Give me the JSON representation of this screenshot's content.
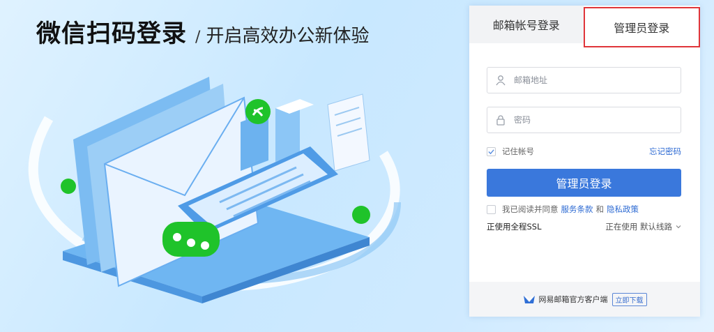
{
  "headline": {
    "title": "微信扫码登录",
    "slash": "/",
    "subtitle": "开启高效办公新体验"
  },
  "tabs": {
    "mail": "邮箱帐号登录",
    "admin": "管理员登录"
  },
  "form": {
    "email_placeholder": "邮箱地址",
    "password_placeholder": "密码",
    "remember_label": "记住帐号",
    "remember_checked": true,
    "forgot_label": "忘记密码",
    "login_button": "管理员登录",
    "agree_prefix": "我已阅读并同意",
    "terms_link": "服务条款",
    "and_text": "和",
    "privacy_link": "隐私政策",
    "agree_checked": false,
    "ssl_text": "正使用全程SSL",
    "route_text": "正在使用 默认线路"
  },
  "footer": {
    "client_text": "网易邮箱官方客户端",
    "download_button": "立即下载"
  },
  "colors": {
    "primary": "#3a78dc",
    "link": "#2e6bd3",
    "highlight": "#e0353a",
    "wechat_green": "#1fc32a"
  },
  "icons": [
    "user-icon",
    "lock-icon",
    "check-icon",
    "chevron-down-icon",
    "mail-client-logo-icon",
    "wechat-miniprogram-icon",
    "wechat-bubble-icon"
  ]
}
